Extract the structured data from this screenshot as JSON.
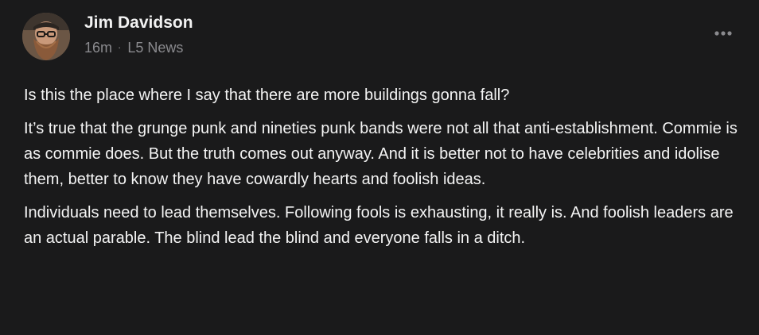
{
  "post": {
    "author": "Jim Davidson",
    "time": "16m",
    "separator": "·",
    "community": "L5 News",
    "more_icon": "more-horizontal-icon",
    "paragraphs": [
      "Is this the place where I say that there are more buildings gonna fall?",
      "It’s true that the grunge punk and nineties punk bands were not all that anti-establishment. Commie is as commie does. But the truth comes out anyway. And it is better not to have celebrities and idolise them, better to know they have cowardly hearts and foolish ideas.",
      "Individuals need to lead themselves. Following fools is exhausting, it really is. And foolish leaders are an actual parable. The blind lead the blind and everyone falls in a ditch."
    ]
  },
  "colors": {
    "background": "#1a1a1b",
    "text": "#f4f4f4",
    "muted": "#8a8a8e"
  }
}
